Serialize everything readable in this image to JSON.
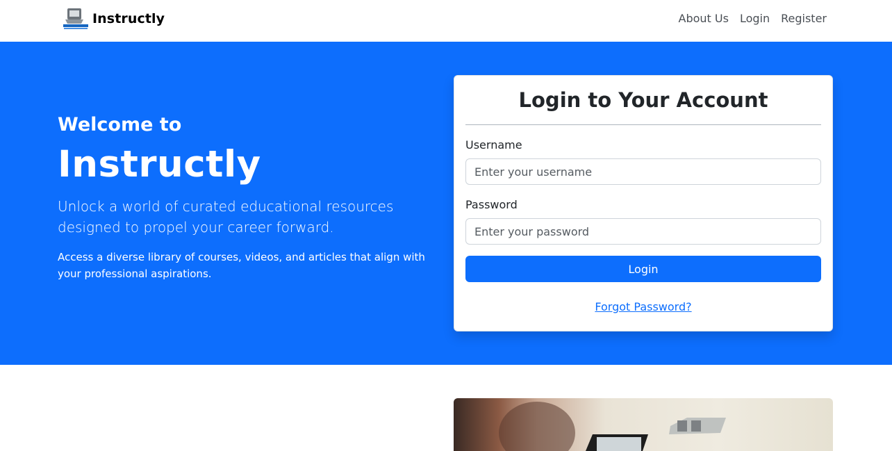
{
  "navbar": {
    "brand": "Instructly",
    "links": [
      "About Us",
      "Login",
      "Register"
    ]
  },
  "hero": {
    "welcome": "Welcome to",
    "title": "Instructly",
    "lead": "Unlock a world of curated educational resources designed to propel your career forward.",
    "sub": "Access a diverse library of courses, videos, and articles that align with your professional aspirations."
  },
  "login": {
    "title": "Login to Your Account",
    "username_label": "Username",
    "username_placeholder": "Enter your username",
    "password_label": "Password",
    "password_placeholder": "Enter your password",
    "button": "Login",
    "forgot": "Forgot Password?"
  },
  "colors": {
    "primary": "#0d6efd",
    "text": "#212529",
    "nav_text": "#4a4f55"
  }
}
